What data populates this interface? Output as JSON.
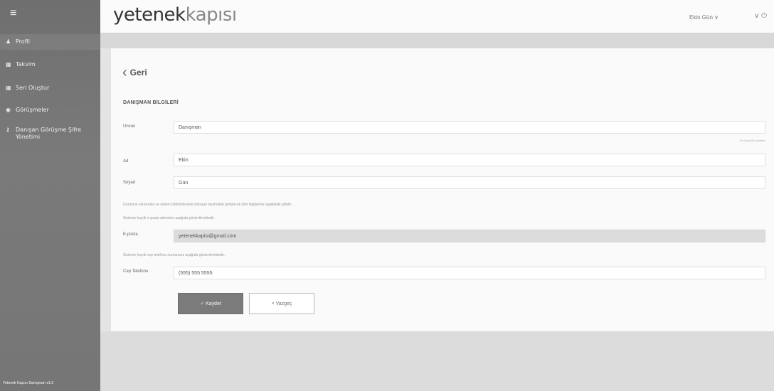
{
  "sidebar": {
    "menu_icon": "hamburger-icon",
    "items": [
      {
        "icon": "user-icon",
        "label": "Profil"
      },
      {
        "icon": "calendar-icon",
        "label": "Takvim"
      },
      {
        "icon": "calendar-icon",
        "label": "Seri Oluştur"
      },
      {
        "icon": "eye-icon",
        "label": "Görüşmeler"
      },
      {
        "icon": "key-icon",
        "label": "Danışan Görüşme Şifre Yönetimi"
      }
    ],
    "footer": "Yetenek Kapısı Danışman v1.0"
  },
  "header": {
    "logo_part1": "yetenek",
    "logo_part2": "kapısı",
    "user_menu": "Ekin Gün ∨",
    "power_menu": "∨ ⏻"
  },
  "content": {
    "back_label": "Geri",
    "section_title": "DANIŞMAN BİLGİLERİ",
    "fields": {
      "title": {
        "label": "Unvan",
        "value": "Danışman"
      },
      "first_name": {
        "label": "Ad",
        "value": "Ekin"
      },
      "last_name": {
        "label": "Soyad",
        "value": "Gün"
      },
      "email": {
        "label": "E-posta",
        "value": "yetenekkapisi@gmail.com"
      },
      "phone": {
        "label": "Cep Telefonu",
        "value": "(555) 555 5555"
      }
    },
    "mini_note": "En fazla 50 karakter",
    "hint_1": "Görüşme ekranında ve sistem bildirimlerinde danışan tarafından görülecek isim bilgileriniz aşağıdaki gibidir.",
    "hint_2": "Sisteme kayıtlı e-posta adresiniz aşağıda gösterilmektedir.",
    "hint_3": "Sisteme kayıtlı cep telefonu numaranız aşağıda gösterilmektedir.",
    "save_label": "✓ Kaydet",
    "cancel_label": "× Vazgeç"
  },
  "colors": {
    "sidebar_bg": "#757575",
    "save_button": "#7b7b7b",
    "readonly_field": "#dcdcdc"
  }
}
